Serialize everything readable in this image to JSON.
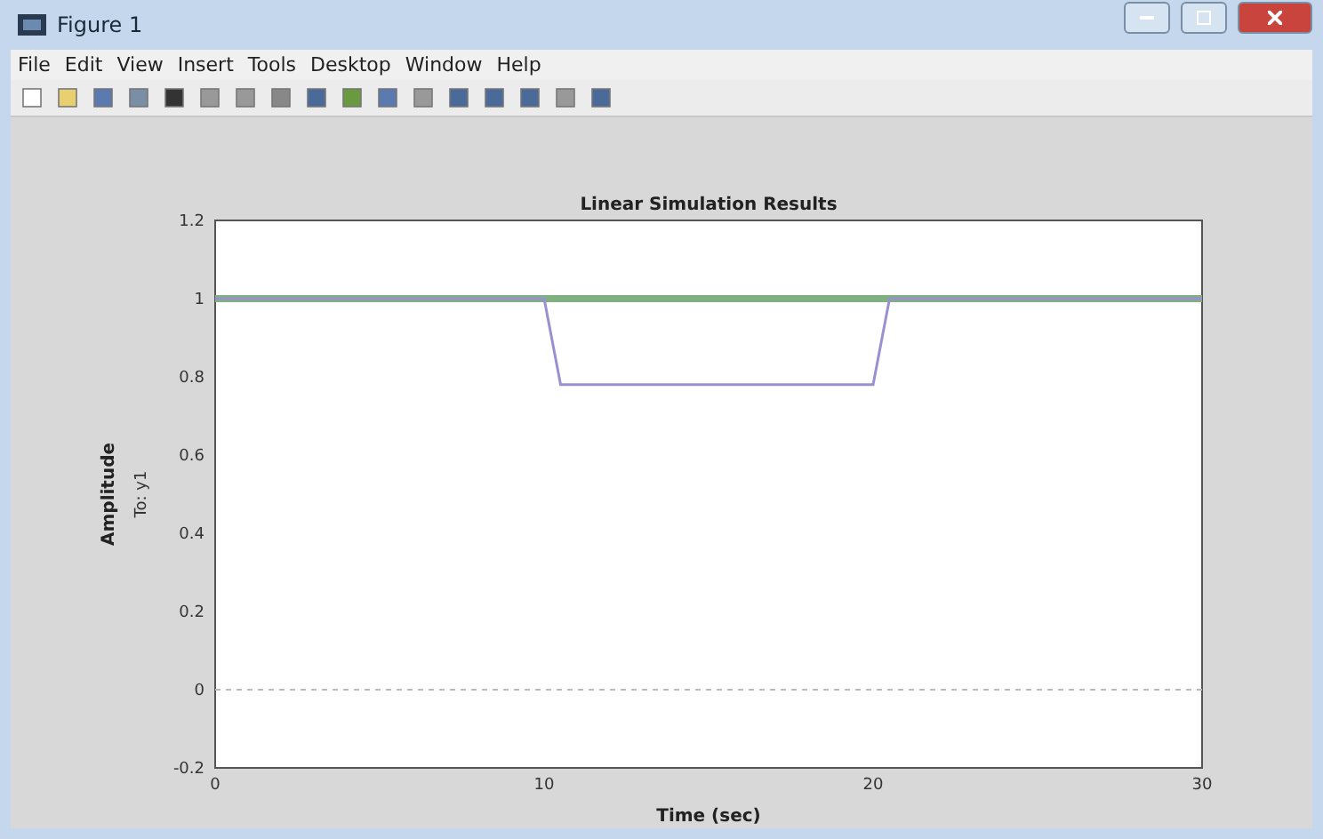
{
  "window": {
    "title": "Figure 1"
  },
  "menu": [
    "File",
    "Edit",
    "View",
    "Insert",
    "Tools",
    "Desktop",
    "Window",
    "Help"
  ],
  "plot": {
    "chart_data": {
      "type": "line",
      "title": "Linear Simulation Results",
      "xlabel": "Time (sec)",
      "ylabel": "Amplitude",
      "x": [
        0,
        10,
        10.5,
        20,
        20.5,
        30
      ],
      "series": [
        {
          "color": "#7fb07f",
          "values": [
            1,
            1,
            1,
            1,
            1,
            1
          ]
        },
        {
          "color": "#9a90d0",
          "values": [
            1,
            1,
            0.78,
            0.78,
            1,
            1
          ]
        }
      ],
      "xlim": [
        0,
        30
      ],
      "ylim": [
        -0.2,
        1.2
      ],
      "xticks": [
        0,
        10,
        20,
        30
      ],
      "yticks": [
        -0.2,
        0,
        0.2,
        0.4,
        0.6,
        0.8,
        1,
        1.2
      ]
    },
    "output_label": "To: y1"
  }
}
